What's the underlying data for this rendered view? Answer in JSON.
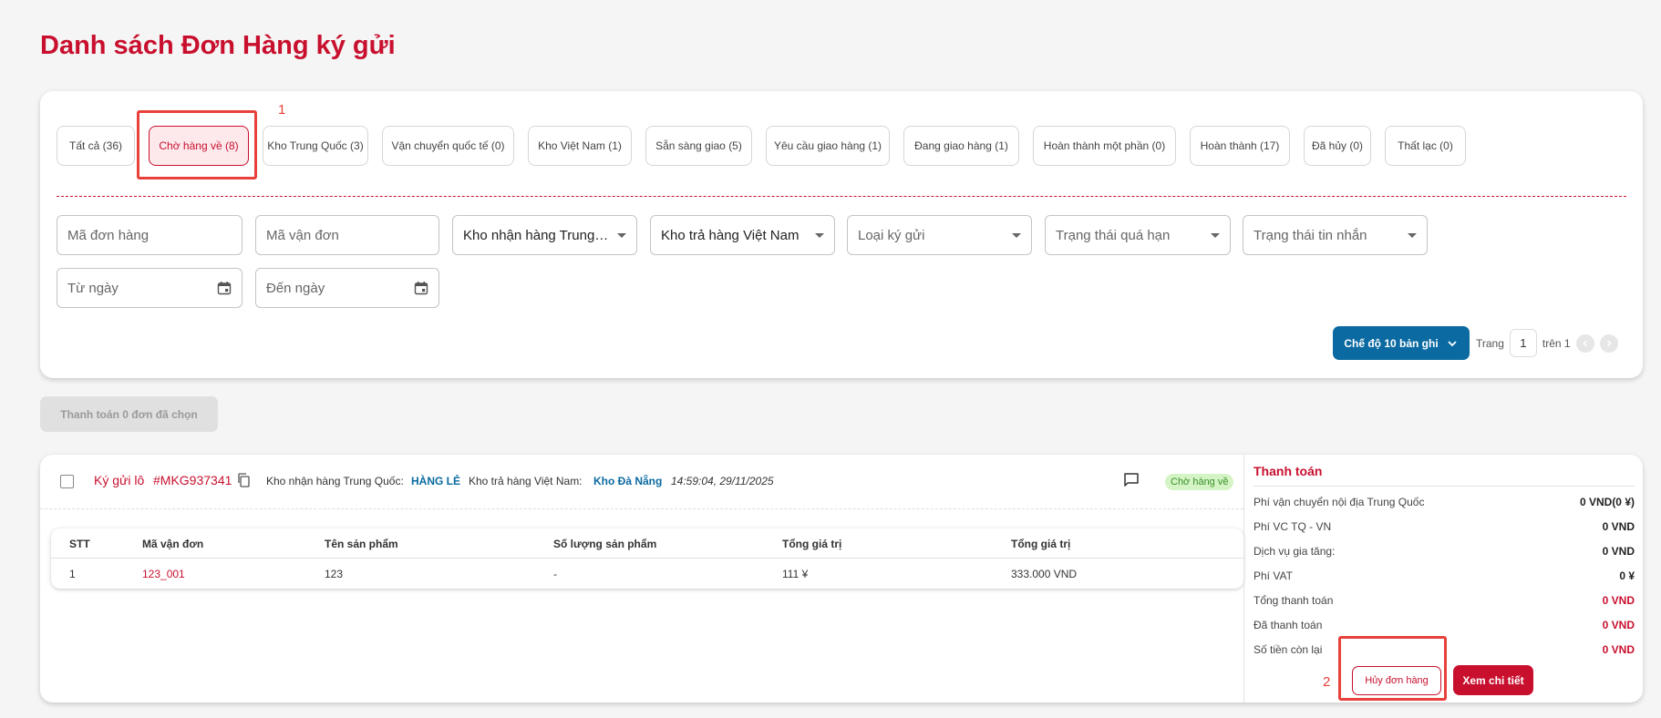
{
  "page_title": "Danh sách Đơn Hàng ký gửi",
  "tabs": [
    {
      "label": "Tất cả (36)"
    },
    {
      "label": "Chờ hàng về (8)"
    },
    {
      "label": "Kho Trung Quốc (3)"
    },
    {
      "label": "Vận chuyển quốc tế (0)"
    },
    {
      "label": "Kho Việt Nam (1)"
    },
    {
      "label": "Sẵn sàng giao (5)"
    },
    {
      "label": "Yêu cầu giao hàng (1)"
    },
    {
      "label": "Đang giao hàng (1)"
    },
    {
      "label": "Hoàn thành một phần (0)"
    },
    {
      "label": "Hoàn thành (17)"
    },
    {
      "label": "Đã hủy (0)"
    },
    {
      "label": "Thất lạc (0)"
    }
  ],
  "active_tab": "Chờ hàng về (8)",
  "filters": {
    "order_code_placeholder": "Mã đơn hàng",
    "waybill_placeholder": "Mã vận đơn",
    "cn_warehouse": "Kho nhận hàng Trung Quốc",
    "vn_warehouse": "Kho trả hàng Việt Nam",
    "consign_type": "Loại ký gửi",
    "overdue_status": "Trạng thái quá hạn",
    "message_status": "Trạng thái tin nhắn",
    "from_date": "Từ ngày",
    "to_date": "Đến ngày"
  },
  "pager": {
    "mode_label": "Chế độ 10 bản ghi",
    "page_label": "Trang",
    "page_value": "1",
    "of_label": "trên 1"
  },
  "pay_selected_label": "Thanh toán 0 đơn đã chọn",
  "order": {
    "type_label": "Ký gửi lô",
    "code": "#MKG937341",
    "cn_label": "Kho nhận hàng Trung Quốc:",
    "cn_value": "HÀNG LẺ",
    "vn_label": "Kho trả hàng Việt Nam:",
    "vn_value": "Kho Đà Nẵng",
    "timestamp": "14:59:04, 29/11/2025",
    "status": "Chờ hàng về",
    "table": {
      "headers": [
        "STT",
        "Mã vận đơn",
        "Tên sản phẩm",
        "Số lượng sản phẩm",
        "Tổng giá trị",
        "Tổng giá trị"
      ],
      "rows": [
        [
          "1",
          "123_001",
          "123",
          "-",
          "111 ¥",
          "333.000 VND"
        ]
      ]
    },
    "payment": {
      "title": "Thanh toán",
      "rows": [
        {
          "label": "Phí vận chuyển nội địa Trung Quốc",
          "value": "0 VND(0 ¥)"
        },
        {
          "label": "Phí VC TQ - VN",
          "value": "0 VND"
        },
        {
          "label": "Dịch vụ gia tăng:",
          "value": "0 VND"
        },
        {
          "label": "Phí VAT",
          "value": "0 ¥"
        },
        {
          "label": "Tổng thanh toán",
          "value": "0 VND"
        },
        {
          "label": "Đã thanh toán",
          "value": "0 VND"
        },
        {
          "label": "Số tiền còn lại",
          "value": "0 VND"
        }
      ]
    },
    "cancel_label": "Hủy đơn hàng",
    "detail_label": "Xem chi tiết"
  },
  "annotations": {
    "marker_1": "1",
    "marker_2": "2"
  },
  "colors": {
    "brand_red": "#c8102e",
    "primary_blue": "#0a6aa1",
    "highlight_red": "#e8403a",
    "status_green_bg": "#d4f4c6"
  }
}
